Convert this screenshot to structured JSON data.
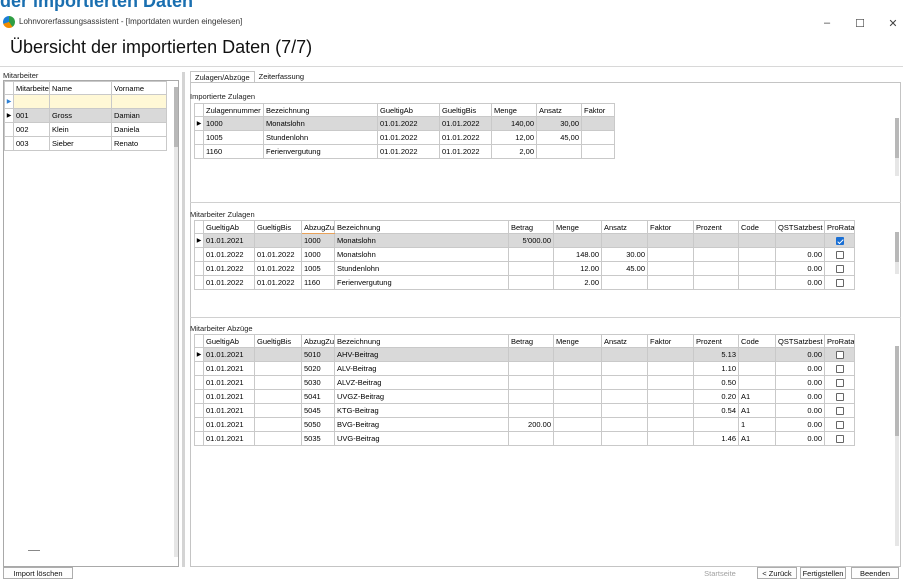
{
  "background_title": "der importierten Daten",
  "window": {
    "title": "Lohnvorerfassungsassistent - [Importdaten wurden eingelesen]",
    "minimize": "–",
    "maximize": "☐",
    "close": "✕"
  },
  "page_title": "Übersicht der importierten Daten (7/7)",
  "left": {
    "section_label": "Mitarbeiter",
    "columns": [
      "Mitarbeiter",
      "Name",
      "Vorname"
    ],
    "rows": [
      {
        "nr": "001",
        "name": "Gross",
        "vorname": "Damian"
      },
      {
        "nr": "002",
        "name": "Klein",
        "vorname": "Daniela"
      },
      {
        "nr": "003",
        "name": "Sieber",
        "vorname": "Renato"
      }
    ]
  },
  "tabs": [
    "Zulagen/Abzüge",
    "Zeiterfassung"
  ],
  "importierte_zulagen": {
    "label": "Importierte Zulagen",
    "columns": [
      "Zulagennummer",
      "Bezeichnung",
      "GueltigAb",
      "GueltigBis",
      "Menge",
      "Ansatz",
      "Faktor"
    ],
    "rows": [
      [
        "1000",
        "Monatslohn",
        "01.01.2022",
        "01.01.2022",
        "140,00",
        "30,00",
        ""
      ],
      [
        "1005",
        "Stundenlohn",
        "01.01.2022",
        "01.01.2022",
        "12,00",
        "45,00",
        ""
      ],
      [
        "1160",
        "Ferienvergutung",
        "01.01.2022",
        "01.01.2022",
        "2,00",
        "",
        ""
      ]
    ]
  },
  "mitarbeiter_zulagen": {
    "label": "Mitarbeiter Zulagen",
    "columns": [
      "GueltigAb",
      "GueltigBis",
      "AbzugZul",
      "Bezeichnung",
      "Betrag",
      "Menge",
      "Ansatz",
      "Faktor",
      "Prozent",
      "Code",
      "QSTSatzbest",
      "ProRata"
    ],
    "rows": [
      [
        "01.01.2021",
        "",
        "1000",
        "Monatslohn",
        "5'000.00",
        "",
        "",
        "",
        "",
        "",
        "",
        "checked"
      ],
      [
        "01.01.2022",
        "01.01.2022",
        "1000",
        "Monatslohn",
        "",
        "148.00",
        "30.00",
        "",
        "",
        "",
        "0.00",
        ""
      ],
      [
        "01.01.2022",
        "01.01.2022",
        "1005",
        "Stundenlohn",
        "",
        "12.00",
        "45.00",
        "",
        "",
        "",
        "0.00",
        ""
      ],
      [
        "01.01.2022",
        "01.01.2022",
        "1160",
        "Ferienvergutung",
        "",
        "2.00",
        "",
        "",
        "",
        "",
        "0.00",
        ""
      ]
    ]
  },
  "mitarbeiter_abzuege": {
    "label": "Mitarbeiter Abzüge",
    "columns": [
      "GueltigAb",
      "GueltigBis",
      "AbzugZul",
      "Bezeichnung",
      "Betrag",
      "Menge",
      "Ansatz",
      "Faktor",
      "Prozent",
      "Code",
      "QSTSatzbest",
      "ProRata"
    ],
    "rows": [
      [
        "01.01.2021",
        "",
        "5010",
        "AHV-Beitrag",
        "",
        "",
        "",
        "",
        "5.13",
        "",
        "0.00",
        ""
      ],
      [
        "01.01.2021",
        "",
        "5020",
        "ALV-Beitrag",
        "",
        "",
        "",
        "",
        "1.10",
        "",
        "0.00",
        ""
      ],
      [
        "01.01.2021",
        "",
        "5030",
        "ALVZ-Beitrag",
        "",
        "",
        "",
        "",
        "0.50",
        "",
        "0.00",
        ""
      ],
      [
        "01.01.2021",
        "",
        "5041",
        "UVGZ-Beitrag",
        "",
        "",
        "",
        "",
        "0.20",
        "A1",
        "0.00",
        ""
      ],
      [
        "01.01.2021",
        "",
        "5045",
        "KTG-Beitrag",
        "",
        "",
        "",
        "",
        "0.54",
        "A1",
        "0.00",
        ""
      ],
      [
        "01.01.2021",
        "",
        "5050",
        "BVG-Beitrag",
        "200.00",
        "",
        "",
        "",
        "",
        "1",
        "0.00",
        ""
      ],
      [
        "01.01.2021",
        "",
        "5035",
        "UVG-Beitrag",
        "",
        "",
        "",
        "",
        "1.46",
        "A1",
        "0.00",
        ""
      ]
    ]
  },
  "footer": {
    "import_loeschen": "Import löschen",
    "startseite": "Startseite",
    "zurueck": "< Zurück",
    "fertigstellen": "Fertigstellen",
    "beenden": "Beenden"
  }
}
